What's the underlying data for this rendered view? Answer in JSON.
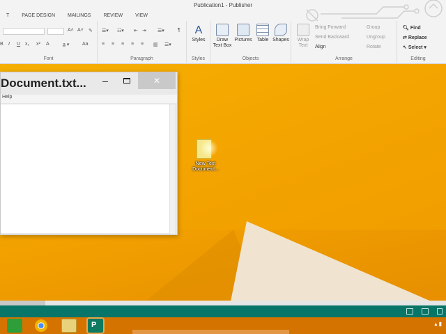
{
  "window": {
    "title": "Publication1 - Publisher"
  },
  "ribbon": {
    "tabs": [
      "T",
      "PAGE DESIGN",
      "MAILINGS",
      "REVIEW",
      "VIEW"
    ],
    "groups": {
      "font": "Font",
      "paragraph": "Paragraph",
      "styles": "Styles",
      "objects": "Objects",
      "arrange": "Arrange",
      "editing": "Editing"
    },
    "styles_button": "Styles",
    "tools": {
      "draw_text_box": "Draw\nText Box",
      "pictures": "Pictures",
      "table": "Table",
      "shapes": "Shapes"
    },
    "arrange": {
      "wrap_text": "Wrap\nText",
      "bring_forward": "Bring Forward",
      "send_backward": "Send Backward",
      "align": "Align",
      "group": "Group",
      "ungroup": "Ungroup",
      "rotate": "Rotate"
    },
    "editing": {
      "find": "Find",
      "replace": "Replace",
      "select": "Select"
    }
  },
  "notepad": {
    "title": "Document.txt...",
    "minimize": "–",
    "close": "✕",
    "menu": "Help",
    "content": ""
  },
  "desktop_icon": {
    "label": "New Text Document..."
  },
  "taskbar": {
    "publisher_label": "P"
  },
  "colors": {
    "desktop": "#f4a500",
    "statusbar": "#077568",
    "taskbar": "#d47300",
    "ribbon": "#f3f3f3"
  },
  "icons": [
    "store-icon",
    "chrome-icon",
    "file-explorer-icon",
    "publisher-icon",
    "text-file-icon"
  ]
}
